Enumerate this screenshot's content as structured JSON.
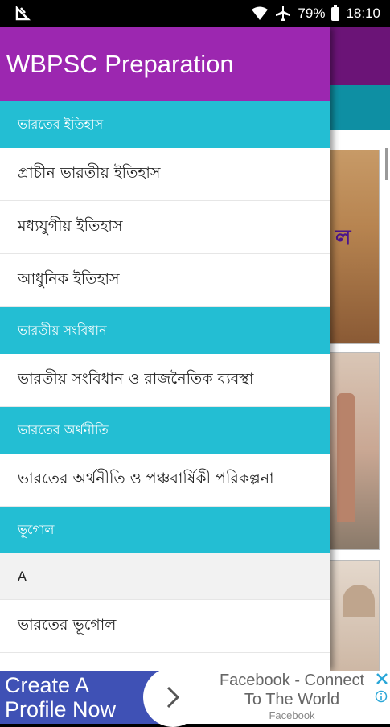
{
  "status_bar": {
    "battery": "79%",
    "time": "18:10"
  },
  "drawer": {
    "title": "WBPSC Preparation",
    "sections": [
      {
        "header": "ভারতের ইতিহাস",
        "items": [
          "প্রাচীন ভারতীয় ইতিহাস",
          "মধ্যযুগীয় ইতিহাস",
          "আধুনিক ইতিহাস"
        ]
      },
      {
        "header": "ভারতীয় সংবিধান",
        "items": [
          "ভারতীয় সংবিধান ও রাজনৈতিক ব্যবস্থা"
        ]
      },
      {
        "header": "ভারতের অর্থনীতি",
        "items": [
          "ভারতের অর্থনীতি ও পঞ্চবার্ষিকী পরিকল্পনা"
        ]
      },
      {
        "header": "ভূগোল",
        "items": [
          "A",
          "ভারতের ভূগোল"
        ]
      }
    ]
  },
  "background": {
    "card_text": "ল"
  },
  "ad": {
    "left_line1": "Create A",
    "left_line2": "Profile Now",
    "title_line1": "Facebook - Connect",
    "title_line2": "To The World",
    "subtitle": "Facebook"
  },
  "colors": {
    "toolbar_purple": "#9c27b0",
    "section_cyan": "#23bed3",
    "ad_blue": "#3f51b5"
  }
}
